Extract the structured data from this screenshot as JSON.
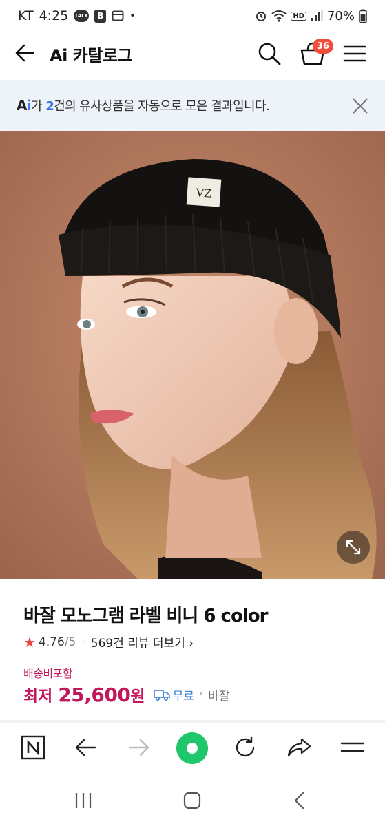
{
  "status_bar": {
    "carrier": "KT",
    "time": "4:25",
    "talk_badge": "TALK",
    "b_badge": "B",
    "dot": "•",
    "hd": "HD",
    "battery": "70%"
  },
  "header": {
    "title": "Ai 카탈로그",
    "cart_count": "36"
  },
  "notice": {
    "ai_a": "A",
    "ai_i": "i",
    "text_before": "가 ",
    "count": "2",
    "text_after": "건의 유사상품을 자동으로 모은 결과입니다."
  },
  "product": {
    "name": "바잘 모노그램 라벨 비니 6 color",
    "rating": "4.76",
    "rating_max": "/5",
    "review_link": "569건 리뷰 더보기",
    "review_chevron": "›",
    "shipping_label": "배송비포함",
    "price_prefix": "최저",
    "price": "25,600",
    "price_unit": "원",
    "free_shipping": "무료",
    "seller_dot": "•",
    "seller": "바잘",
    "image_label": "VZ"
  },
  "colors": {
    "accent_price": "#c2185b",
    "badge": "#f04e3a",
    "link_blue": "#2f6fe8",
    "green_button": "#1ec76a",
    "star": "#e8453c"
  },
  "icons": {
    "back": "back-arrow-icon",
    "search": "search-icon",
    "cart": "cart-basket-icon",
    "menu": "hamburger-menu-icon",
    "close": "close-icon",
    "expand": "expand-icon",
    "star": "star-icon",
    "truck": "truck-icon"
  }
}
